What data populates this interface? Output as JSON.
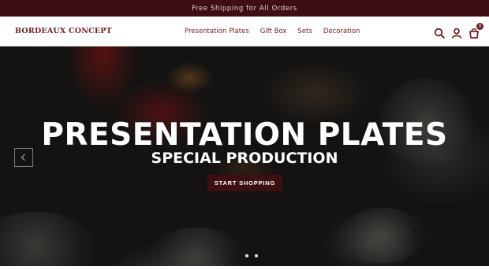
{
  "announcement": {
    "text": "Free Shipping for All Orders"
  },
  "header": {
    "logo_text": "BORDEAUX CONCEPT",
    "nav": [
      {
        "label": "Presentation Plates"
      },
      {
        "label": "Gift Box"
      },
      {
        "label": "Sets"
      },
      {
        "label": "Decoration"
      }
    ],
    "icons": [
      "search-icon",
      "account-icon",
      "cart-icon"
    ],
    "cart_count": "0"
  },
  "hero": {
    "title": "PRESENTATION PLATES",
    "subtitle": "SPECIAL PRODUCTION",
    "cta_label": "START SHOPPING",
    "slide_count": 2
  },
  "colors": {
    "brand": "#6b1f24",
    "topbar": "#3d0f12",
    "button": "#3d0f12"
  }
}
